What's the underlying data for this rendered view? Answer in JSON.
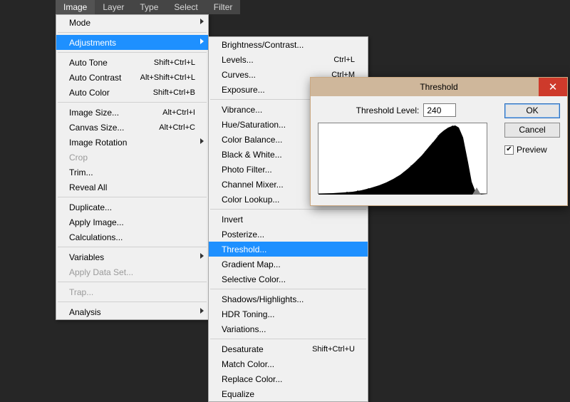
{
  "menubar": {
    "items": [
      {
        "label": "Image",
        "selected": true
      },
      {
        "label": "Layer"
      },
      {
        "label": "Type"
      },
      {
        "label": "Select"
      },
      {
        "label": "Filter"
      }
    ]
  },
  "image_menu": [
    {
      "type": "item",
      "label": "Mode",
      "submenu": true
    },
    {
      "type": "sep"
    },
    {
      "type": "item",
      "label": "Adjustments",
      "submenu": true,
      "highlight": true
    },
    {
      "type": "sep"
    },
    {
      "type": "item",
      "label": "Auto Tone",
      "shortcut": "Shift+Ctrl+L"
    },
    {
      "type": "item",
      "label": "Auto Contrast",
      "shortcut": "Alt+Shift+Ctrl+L"
    },
    {
      "type": "item",
      "label": "Auto Color",
      "shortcut": "Shift+Ctrl+B"
    },
    {
      "type": "sep"
    },
    {
      "type": "item",
      "label": "Image Size...",
      "shortcut": "Alt+Ctrl+I"
    },
    {
      "type": "item",
      "label": "Canvas Size...",
      "shortcut": "Alt+Ctrl+C"
    },
    {
      "type": "item",
      "label": "Image Rotation",
      "submenu": true
    },
    {
      "type": "item",
      "label": "Crop",
      "disabled": true
    },
    {
      "type": "item",
      "label": "Trim..."
    },
    {
      "type": "item",
      "label": "Reveal All"
    },
    {
      "type": "sep"
    },
    {
      "type": "item",
      "label": "Duplicate..."
    },
    {
      "type": "item",
      "label": "Apply Image..."
    },
    {
      "type": "item",
      "label": "Calculations..."
    },
    {
      "type": "sep"
    },
    {
      "type": "item",
      "label": "Variables",
      "submenu": true
    },
    {
      "type": "item",
      "label": "Apply Data Set...",
      "disabled": true
    },
    {
      "type": "sep"
    },
    {
      "type": "item",
      "label": "Trap...",
      "disabled": true
    },
    {
      "type": "sep"
    },
    {
      "type": "item",
      "label": "Analysis",
      "submenu": true
    }
  ],
  "adjustments_menu": [
    {
      "type": "item",
      "label": "Brightness/Contrast..."
    },
    {
      "type": "item",
      "label": "Levels...",
      "shortcut": "Ctrl+L"
    },
    {
      "type": "item",
      "label": "Curves...",
      "shortcut": "Ctrl+M"
    },
    {
      "type": "item",
      "label": "Exposure..."
    },
    {
      "type": "sep"
    },
    {
      "type": "item",
      "label": "Vibrance..."
    },
    {
      "type": "item",
      "label": "Hue/Saturation..."
    },
    {
      "type": "item",
      "label": "Color Balance..."
    },
    {
      "type": "item",
      "label": "Black & White..."
    },
    {
      "type": "item",
      "label": "Photo Filter..."
    },
    {
      "type": "item",
      "label": "Channel Mixer..."
    },
    {
      "type": "item",
      "label": "Color Lookup..."
    },
    {
      "type": "sep"
    },
    {
      "type": "item",
      "label": "Invert"
    },
    {
      "type": "item",
      "label": "Posterize..."
    },
    {
      "type": "item",
      "label": "Threshold...",
      "highlight": true
    },
    {
      "type": "item",
      "label": "Gradient Map..."
    },
    {
      "type": "item",
      "label": "Selective Color..."
    },
    {
      "type": "sep"
    },
    {
      "type": "item",
      "label": "Shadows/Highlights..."
    },
    {
      "type": "item",
      "label": "HDR Toning..."
    },
    {
      "type": "item",
      "label": "Variations..."
    },
    {
      "type": "sep"
    },
    {
      "type": "item",
      "label": "Desaturate",
      "shortcut": "Shift+Ctrl+U"
    },
    {
      "type": "item",
      "label": "Match Color..."
    },
    {
      "type": "item",
      "label": "Replace Color..."
    },
    {
      "type": "item",
      "label": "Equalize"
    }
  ],
  "dialog": {
    "title": "Threshold",
    "field_label": "Threshold Level:",
    "field_value": "240",
    "ok": "OK",
    "cancel": "Cancel",
    "preview": "Preview",
    "preview_checked": true,
    "close_glyph": "✕",
    "check_glyph": "✔"
  }
}
